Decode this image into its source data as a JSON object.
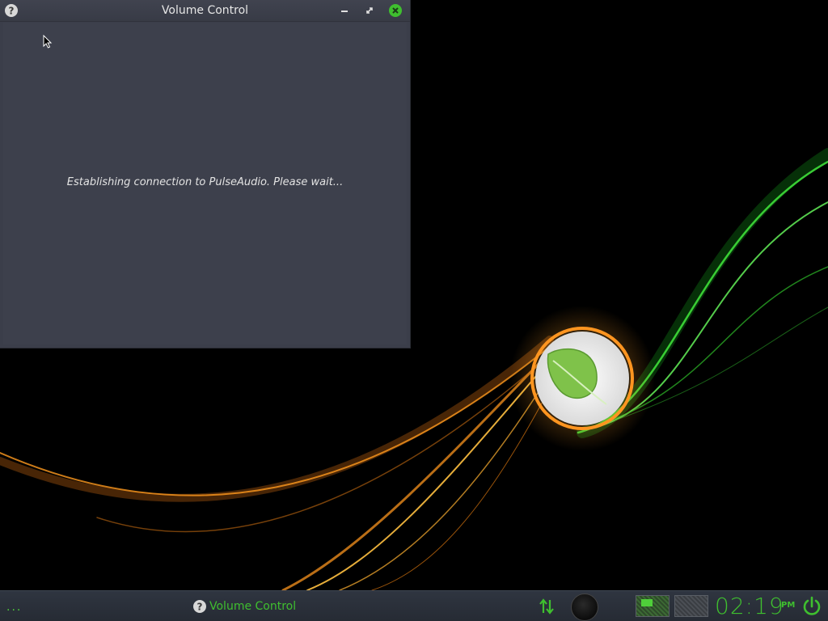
{
  "window": {
    "title": "Volume Control",
    "status_message": "Establishing connection to PulseAudio. Please wait...",
    "buttons": {
      "help": "help-icon",
      "minimize": "minimize-icon",
      "maximize": "maximize-icon",
      "close": "close-icon"
    }
  },
  "taskbar": {
    "launcher": "...",
    "tasks": [
      {
        "label": "Volume Control",
        "icon": "help-icon"
      }
    ],
    "clock": {
      "time": "02:19",
      "period": "PM"
    }
  },
  "colors": {
    "accent": "#3fbf2f",
    "window_bg": "#3d404c",
    "taskbar_bg": "#2b313b"
  }
}
